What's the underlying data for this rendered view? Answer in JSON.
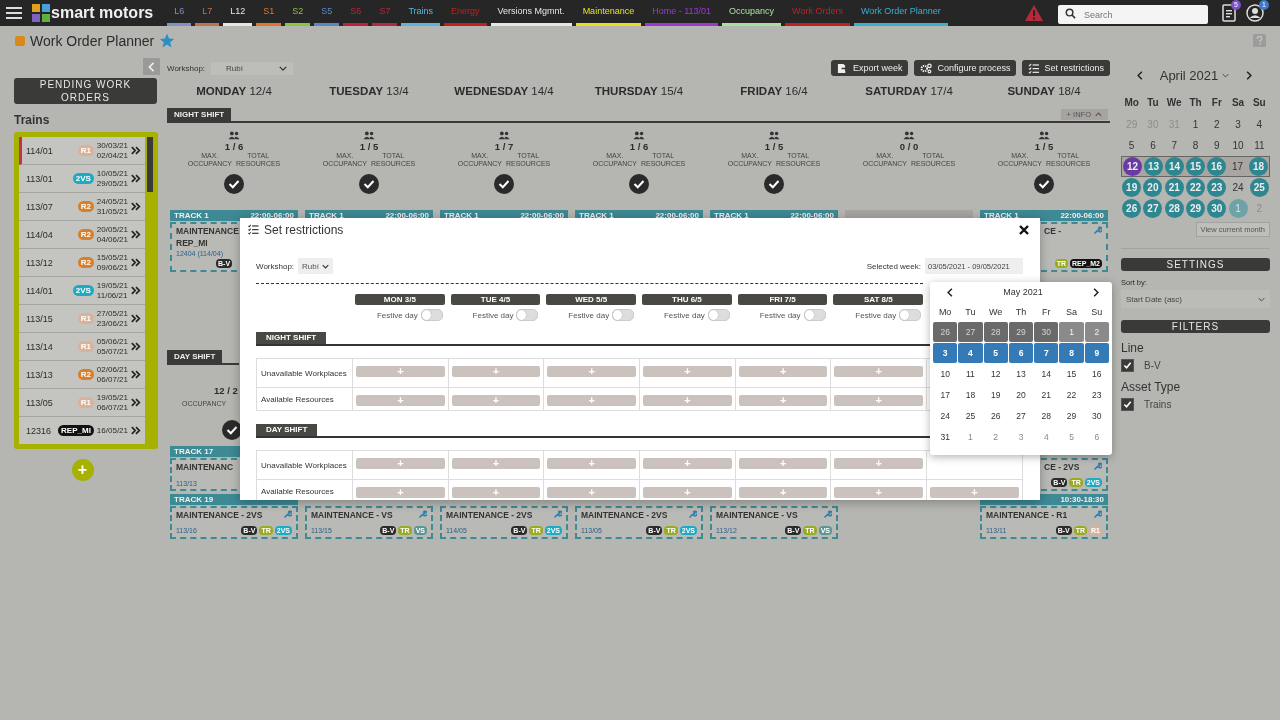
{
  "topbar": {
    "brand": "smart motors",
    "nav": [
      {
        "label": "L6",
        "color": "#8190c4"
      },
      {
        "label": "L7",
        "color": "#c4704c"
      },
      {
        "label": "L12",
        "color": "#e6e6e6"
      },
      {
        "label": "S1",
        "color": "#e0782a"
      },
      {
        "label": "S2",
        "color": "#8cc43c"
      },
      {
        "label": "S5",
        "color": "#5a86c8"
      },
      {
        "label": "S6",
        "color": "#c0203c"
      },
      {
        "label": "S7",
        "color": "#b02a3c"
      },
      {
        "label": "Trains",
        "color": "#5ab4e0"
      },
      {
        "label": "Energy",
        "color": "#c02020"
      },
      {
        "label": "Versions Mgmnt.",
        "color": "#e6e6e6"
      },
      {
        "label": "Maintenance",
        "color": "#e6e020"
      },
      {
        "label": "Home - 113/01",
        "color": "#9a3ad0"
      },
      {
        "label": "Occupancy",
        "color": "#a8e0a0"
      },
      {
        "label": "Work Orders",
        "color": "#c02020"
      },
      {
        "label": "Work Order Planner",
        "color": "#3ab0d0"
      }
    ],
    "search": {
      "placeholder": "Search"
    },
    "documents_badge": "5",
    "user_badge": "1"
  },
  "page": {
    "title": "Work Order Planner"
  },
  "pending": {
    "title": "PENDING WORK ORDERS",
    "group": "Trains",
    "add": "+",
    "items": [
      {
        "code": "114/01",
        "tag": {
          "label": "R1",
          "color": "#d9b29a"
        },
        "start": "30/03/21",
        "end": "02/04/21",
        "flagged": true
      },
      {
        "code": "113/01",
        "tag": {
          "label": "2VS",
          "color": "#1ea9c4"
        },
        "start": "10/05/21",
        "end": "29/05/21",
        "flagged": false
      },
      {
        "code": "113/07",
        "tag": {
          "label": "R2",
          "color": "#d4802c"
        },
        "start": "24/05/21",
        "end": "31/05/21",
        "flagged": false
      },
      {
        "code": "114/04",
        "tag": {
          "label": "R2",
          "color": "#d4802c"
        },
        "start": "20/05/21",
        "end": "04/06/21",
        "flagged": false
      },
      {
        "code": "113/12",
        "tag": {
          "label": "R2",
          "color": "#d4802c"
        },
        "start": "15/05/21",
        "end": "09/06/21",
        "flagged": false
      },
      {
        "code": "114/01",
        "tag": {
          "label": "2VS",
          "color": "#1ea9c4"
        },
        "start": "19/05/21",
        "end": "11/06/21",
        "flagged": false
      },
      {
        "code": "113/15",
        "tag": {
          "label": "R1",
          "color": "#d9b29a"
        },
        "start": "27/05/21",
        "end": "23/06/21",
        "flagged": false
      },
      {
        "code": "113/14",
        "tag": {
          "label": "R1",
          "color": "#d9b29a"
        },
        "start": "05/06/21",
        "end": "05/07/21",
        "flagged": false
      },
      {
        "code": "113/13",
        "tag": {
          "label": "R2",
          "color": "#d4802c"
        },
        "start": "02/06/21",
        "end": "06/07/21",
        "flagged": false
      },
      {
        "code": "113/05",
        "tag": {
          "label": "R1",
          "color": "#d9b29a"
        },
        "start": "19/05/21",
        "end": "06/07/21",
        "flagged": false
      },
      {
        "code": "12316",
        "tag": {
          "label": "REP_MI",
          "color": "#111111"
        },
        "start": "16/05/21",
        "flagged": false
      }
    ]
  },
  "planner": {
    "workshop_label": "Workshop:",
    "workshop": "Rubí",
    "actions": [
      {
        "kind": "export",
        "label": "Export week"
      },
      {
        "kind": "configure",
        "label": "Configure process"
      },
      {
        "kind": "restrict",
        "label": "Set restrictions"
      }
    ],
    "days": [
      {
        "name": "MONDAY",
        "date": "12/4"
      },
      {
        "name": "TUESDAY",
        "date": "13/4"
      },
      {
        "name": "WEDNESDAY",
        "date": "14/4"
      },
      {
        "name": "THURSDAY",
        "date": "15/4"
      },
      {
        "name": "FRIDAY",
        "date": "16/4"
      },
      {
        "name": "SATURDAY",
        "date": "17/4"
      },
      {
        "name": "SUNDAY",
        "date": "18/4"
      }
    ],
    "night_shift": {
      "label": "NIGHT SHIFT",
      "info": "+ INFO",
      "occupancy": [
        {
          "kind": "full",
          "value": "1 / 6",
          "labels": [
            "MAX. OCCUPANCY",
            "TOTAL RESOURCES"
          ],
          "ok": true
        },
        {
          "kind": "full",
          "value": "1 / 5",
          "labels": [
            "MAX. OCCUPANCY",
            "TOTAL RESOURCES"
          ],
          "ok": true
        },
        {
          "kind": "full",
          "value": "1 / 7",
          "labels": [
            "MAX. OCCUPANCY",
            "TOTAL RESOURCES"
          ],
          "ok": true
        },
        {
          "kind": "full",
          "value": "1 / 6",
          "labels": [
            "MAX. OCCUPANCY",
            "TOTAL RESOURCES"
          ],
          "ok": true
        },
        {
          "kind": "full",
          "value": "1 / 5",
          "labels": [
            "MAX. OCCUPANCY",
            "TOTAL RESOURCES"
          ],
          "ok": true
        },
        {
          "kind": "full",
          "value": "0 / 0",
          "labels": [
            "MAX. OCCUPANCY",
            "TOTAL RESOURCES"
          ],
          "ok": false
        },
        {
          "kind": "full",
          "value": "1 / 5",
          "labels": [
            "MAX. OCCUPANCY",
            "TOTAL RESOURCES"
          ],
          "ok": true
        }
      ],
      "tracks": [
        {
          "kind": "track",
          "track": "TRACK 1",
          "time": "22:00-06:00"
        },
        {
          "kind": "track",
          "track": "TRACK 1",
          "time": "22:00-06:00"
        },
        {
          "kind": "track",
          "track": "TRACK 1",
          "time": "22:00-06:00"
        },
        {
          "kind": "track",
          "track": "TRACK 1",
          "time": "22:00-06:00"
        },
        {
          "kind": "track",
          "track": "TRACK 1",
          "time": "22:00-06:00"
        },
        {
          "kind": "empty"
        },
        {
          "kind": "track",
          "track": "TRACK 1",
          "time": "22:00-06:00"
        }
      ],
      "cards": [
        {
          "kind": "left-part",
          "title": "MAINTENANCE",
          "subtitle": "REP_MI",
          "code": "12404 (114/04)",
          "tags": [
            {
              "label": "B-V",
              "color": "#2b2b2b"
            }
          ]
        },
        {
          "kind": "right-part",
          "title": "CE -",
          "wrench": true,
          "tags": [
            {
              "label": "TR",
              "color": "#9aaa22"
            },
            {
              "label": "REP_M2",
              "color": "#111111"
            }
          ]
        }
      ]
    },
    "day_shift": {
      "label": "DAY SHIFT",
      "occupancy": [
        {
          "kind": "left-part",
          "value": "12 / 2",
          "labels": [
            "OCCUPANCY"
          ],
          "ok": true
        }
      ],
      "track_rows": [
        {
          "tracks": [
            {
              "kind": "left-part",
              "track": "TRACK 17"
            }
          ],
          "cards": [
            {
              "kind": "left-part",
              "title": "MAINTENANC",
              "code": "113/13"
            },
            {
              "kind": "right-part",
              "title": "CE - 2VS",
              "wrench": true,
              "tags": [
                {
                  "label": "B-V",
                  "color": "#2b2b2b"
                },
                {
                  "label": "TR",
                  "color": "#9aaa22"
                },
                {
                  "label": "2VS",
                  "color": "#1ea9c4"
                }
              ]
            }
          ]
        },
        {
          "tracks": [
            {
              "kind": "left-part",
              "track": "TRACK 19"
            },
            {
              "kind": "right-part",
              "time": "10:30-18:30"
            }
          ],
          "cards": [
            {
              "kind": "full",
              "title": "MAINTENANCE - 2VS",
              "code": "113/16",
              "wrench": true,
              "tags": [
                {
                  "label": "B-V",
                  "color": "#2b2b2b"
                },
                {
                  "label": "TR",
                  "color": "#9aaa22"
                },
                {
                  "label": "2VS",
                  "color": "#1ea9c4"
                }
              ]
            },
            {
              "kind": "full",
              "title": "MAINTENANCE - VS",
              "code": "113/15",
              "wrench": true,
              "tags": [
                {
                  "label": "B-V",
                  "color": "#2b2b2b"
                },
                {
                  "label": "TR",
                  "color": "#9aaa22"
                },
                {
                  "label": "VS",
                  "color": "#5e9492"
                }
              ]
            },
            {
              "kind": "full",
              "title": "MAINTENANCE - 2VS",
              "code": "114/05",
              "wrench": true,
              "tags": [
                {
                  "label": "B-V",
                  "color": "#2b2b2b"
                },
                {
                  "label": "TR",
                  "color": "#9aaa22"
                },
                {
                  "label": "2VS",
                  "color": "#1ea9c4"
                }
              ]
            },
            {
              "kind": "full",
              "title": "MAINTENANCE - 2VS",
              "code": "113/05",
              "wrench": true,
              "tags": [
                {
                  "label": "B-V",
                  "color": "#2b2b2b"
                },
                {
                  "label": "TR",
                  "color": "#9aaa22"
                },
                {
                  "label": "2VS",
                  "color": "#1ea9c4"
                }
              ]
            },
            {
              "kind": "full",
              "title": "MAINTENANCE - VS",
              "code": "113/12",
              "wrench": true,
              "tags": [
                {
                  "label": "B-V",
                  "color": "#2b2b2b"
                },
                {
                  "label": "TR",
                  "color": "#9aaa22"
                },
                {
                  "label": "VS",
                  "color": "#5e9492"
                }
              ]
            },
            {
              "kind": "empty"
            },
            {
              "kind": "full",
              "title": "MAINTENANCE - R1",
              "code": "113/11",
              "wrench": true,
              "tags": [
                {
                  "label": "B-V",
                  "color": "#2b2b2b"
                },
                {
                  "label": "TR",
                  "color": "#9aaa22"
                },
                {
                  "label": "R1",
                  "color": "#d9b29a"
                }
              ]
            }
          ]
        }
      ]
    }
  },
  "calendar": {
    "month": "April 2021",
    "weekdays": [
      "Mo",
      "Tu",
      "We",
      "Th",
      "Fr",
      "Sa",
      "Su"
    ],
    "view_current": "View current month",
    "weeks": [
      {
        "selected": false,
        "days": [
          {
            "label": "29",
            "kind": "other"
          },
          {
            "label": "30",
            "kind": "other"
          },
          {
            "label": "31",
            "kind": "other"
          },
          {
            "label": "1",
            "kind": "plain"
          },
          {
            "label": "2",
            "kind": "plain"
          },
          {
            "label": "3",
            "kind": "plain"
          },
          {
            "label": "4",
            "kind": "plain"
          }
        ]
      },
      {
        "selected": false,
        "days": [
          {
            "label": "5",
            "kind": "plain"
          },
          {
            "label": "6",
            "kind": "plain"
          },
          {
            "label": "7",
            "kind": "plain"
          },
          {
            "label": "8",
            "kind": "plain"
          },
          {
            "label": "9",
            "kind": "plain"
          },
          {
            "label": "10",
            "kind": "plain"
          },
          {
            "label": "11",
            "kind": "plain"
          }
        ]
      },
      {
        "selected": true,
        "days": [
          {
            "label": "12",
            "kind": "today"
          },
          {
            "label": "13",
            "kind": "marked"
          },
          {
            "label": "14",
            "kind": "marked"
          },
          {
            "label": "15",
            "kind": "marked"
          },
          {
            "label": "16",
            "kind": "marked"
          },
          {
            "label": "17",
            "kind": "plain"
          },
          {
            "label": "18",
            "kind": "marked"
          }
        ]
      },
      {
        "selected": false,
        "days": [
          {
            "label": "19",
            "kind": "marked"
          },
          {
            "label": "20",
            "kind": "marked"
          },
          {
            "label": "21",
            "kind": "marked"
          },
          {
            "label": "22",
            "kind": "marked"
          },
          {
            "label": "23",
            "kind": "marked"
          },
          {
            "label": "24",
            "kind": "plain"
          },
          {
            "label": "25",
            "kind": "marked"
          }
        ]
      },
      {
        "selected": false,
        "days": [
          {
            "label": "26",
            "kind": "marked"
          },
          {
            "label": "27",
            "kind": "marked"
          },
          {
            "label": "28",
            "kind": "marked"
          },
          {
            "label": "29",
            "kind": "marked"
          },
          {
            "label": "30",
            "kind": "marked"
          },
          {
            "label": "1",
            "kind": "other-marked"
          },
          {
            "label": "2",
            "kind": "other"
          }
        ]
      }
    ]
  },
  "settings": {
    "title": "SETTINGS",
    "sort_label": "Sort by:",
    "sort": "Start Date (asc)"
  },
  "filters": {
    "title": "FILTERS",
    "groups": [
      {
        "label": "Line",
        "options": [
          {
            "label": "B-V",
            "checked": true
          }
        ]
      },
      {
        "label": "Asset Type",
        "options": [
          {
            "label": "Trains",
            "checked": true
          }
        ]
      }
    ]
  },
  "restrictions": {
    "title": "Set restrictions",
    "workshop_label": "Workshop:",
    "workshop": "Rubí",
    "week_label": "Selected week:",
    "week": "03/05/2021 - 09/05/2021",
    "days": [
      {
        "label": "MON 3/5",
        "festive_label": "Festive day",
        "festive": false
      },
      {
        "label": "TUE 4/5",
        "festive_label": "Festive day",
        "festive": false
      },
      {
        "label": "WED 5/5",
        "festive_label": "Festive day",
        "festive": false
      },
      {
        "label": "THU 6/5",
        "festive_label": "Festive day",
        "festive": false
      },
      {
        "label": "FRI 7/5",
        "festive_label": "Festive day",
        "festive": false
      },
      {
        "label": "SAT 8/5",
        "festive_label": "Festive day",
        "festive": false
      }
    ],
    "shifts": [
      {
        "label": "NIGHT SHIFT",
        "rows": [
          {
            "label": "Unavailable Workplaces",
            "buttons": [
              "+",
              "+",
              "+",
              "+",
              "+",
              "+"
            ]
          },
          {
            "label": "Available Resources",
            "buttons": [
              "+",
              "+",
              "+",
              "+",
              "+",
              "+"
            ]
          }
        ]
      },
      {
        "label": "DAY SHIFT",
        "rows": [
          {
            "label": "Unavailable Workplaces",
            "buttons": [
              "+",
              "+",
              "+",
              "+",
              "+",
              "+"
            ]
          },
          {
            "label": "Available Resources",
            "buttons": [
              "+",
              "+",
              "+",
              "+",
              "+",
              "+",
              "+"
            ]
          }
        ]
      }
    ]
  },
  "datepicker": {
    "month": "May 2021",
    "weekdays": [
      "Mo",
      "Tu",
      "We",
      "Th",
      "Fr",
      "Sa",
      "Su"
    ],
    "weeks": [
      {
        "highlighted": true,
        "selected": false,
        "days": [
          {
            "label": "26",
            "other": true
          },
          {
            "label": "27",
            "other": true
          },
          {
            "label": "28",
            "other": true
          },
          {
            "label": "29",
            "other": true
          },
          {
            "label": "30",
            "other": true
          },
          {
            "label": "1",
            "other": false
          },
          {
            "label": "2",
            "other": false
          }
        ]
      },
      {
        "highlighted": false,
        "selected": true,
        "days": [
          {
            "label": "3",
            "other": false
          },
          {
            "label": "4",
            "other": false
          },
          {
            "label": "5",
            "other": false
          },
          {
            "label": "6",
            "other": false
          },
          {
            "label": "7",
            "other": false
          },
          {
            "label": "8",
            "other": false
          },
          {
            "label": "9",
            "other": false
          }
        ]
      },
      {
        "highlighted": false,
        "selected": false,
        "days": [
          {
            "label": "10",
            "other": false
          },
          {
            "label": "11",
            "other": false
          },
          {
            "label": "12",
            "other": false
          },
          {
            "label": "13",
            "other": false
          },
          {
            "label": "14",
            "other": false
          },
          {
            "label": "15",
            "other": false
          },
          {
            "label": "16",
            "other": false
          }
        ]
      },
      {
        "highlighted": false,
        "selected": false,
        "days": [
          {
            "label": "17",
            "other": false
          },
          {
            "label": "18",
            "other": false
          },
          {
            "label": "19",
            "other": false
          },
          {
            "label": "20",
            "other": false
          },
          {
            "label": "21",
            "other": false
          },
          {
            "label": "22",
            "other": false
          },
          {
            "label": "23",
            "other": false
          }
        ]
      },
      {
        "highlighted": false,
        "selected": false,
        "days": [
          {
            "label": "24",
            "other": false
          },
          {
            "label": "25",
            "other": false
          },
          {
            "label": "26",
            "other": false
          },
          {
            "label": "27",
            "other": false
          },
          {
            "label": "28",
            "other": false
          },
          {
            "label": "29",
            "other": false
          },
          {
            "label": "30",
            "other": false
          }
        ]
      },
      {
        "highlighted": false,
        "selected": false,
        "days": [
          {
            "label": "31",
            "other": false
          },
          {
            "label": "1",
            "other": true
          },
          {
            "label": "2",
            "other": true
          },
          {
            "label": "3",
            "other": true
          },
          {
            "label": "4",
            "other": true
          },
          {
            "label": "5",
            "other": true
          },
          {
            "label": "6",
            "other": true
          }
        ]
      }
    ]
  }
}
